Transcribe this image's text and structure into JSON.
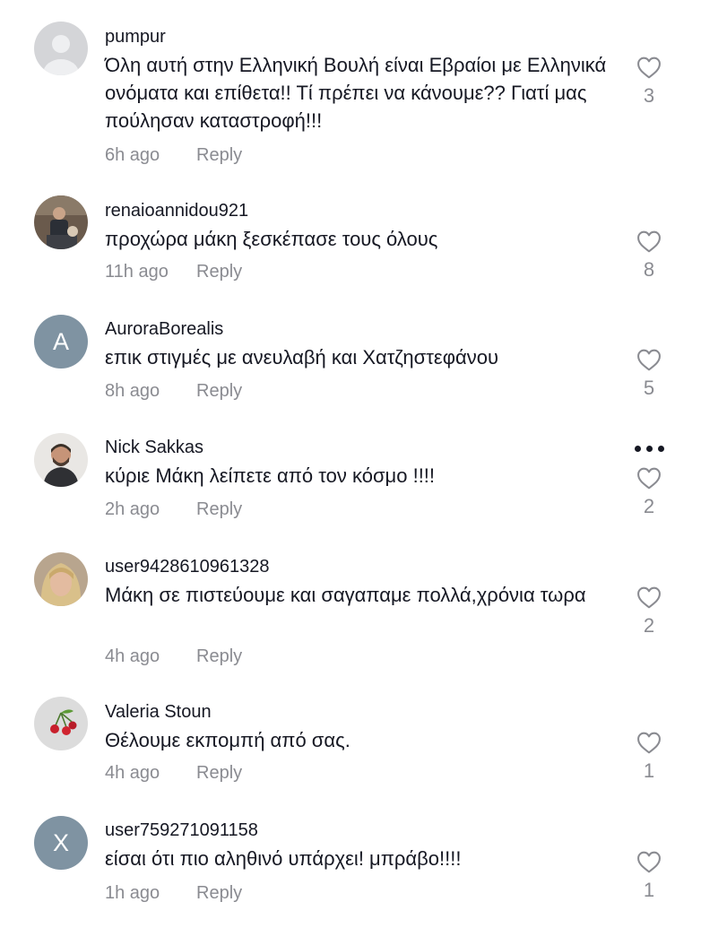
{
  "comments": [
    {
      "username": "pumpur",
      "text": "Όλη αυτή στην Ελληνική Βουλή είναι Εβραίοι με Ελληνικά ονόματα και επίθετα!! Τί πρέπει να κάνουμε?? Γιατί μας πούλησαν καταστροφή!!!",
      "time": "6h ago",
      "reply": "Reply",
      "likes": "3",
      "avatar": "default-avatar"
    },
    {
      "username": "renaioannidou921",
      "text": "προχώρα μάκη ξεσκέπασε τους όλους",
      "time": "11h ago",
      "reply": "Reply",
      "likes": "8",
      "avatar": "photo-avatar"
    },
    {
      "username": "AuroraBorealis",
      "text": "επικ στιγμές με ανευλαβή και Χατζηστεφάνου",
      "time": "8h ago",
      "reply": "Reply",
      "likes": "5",
      "avatar_letter": "A"
    },
    {
      "username": "Nick Sakkas",
      "text": "κύριε Μάκη λείπετε από τον κόσμο !!!!",
      "time": "2h ago",
      "reply": "Reply",
      "likes": "2",
      "avatar": "photo-avatar"
    },
    {
      "username": "user9428610961328",
      "text": "Μάκη σε πιστεύουμε και σαγαπαμε πολλά,χρόνια τωρα",
      "time": "4h ago",
      "reply": "Reply",
      "likes": "2",
      "avatar": "photo-avatar"
    },
    {
      "username": "Valeria Stoun",
      "text": "Θέλουμε εκπομπή από σας.",
      "time": "4h ago",
      "reply": "Reply",
      "likes": "1",
      "avatar": "cherry-avatar"
    },
    {
      "username": "user759271091158",
      "text": "είσαι ότι πιο αληθινό υπάρχει! μπράβο!!!!",
      "time": "1h ago",
      "reply": "Reply",
      "likes": "1",
      "avatar_letter": "X"
    }
  ],
  "icons": {
    "like": "heart-outline-icon",
    "more": "more-options-icon"
  },
  "colors": {
    "text": "#161823",
    "muted": "#8a8b91",
    "letter_avatar": "#7f93a2",
    "icon": "#8a8b91"
  }
}
